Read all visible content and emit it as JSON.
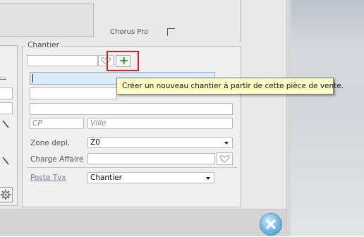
{
  "top": {
    "chorus_label": "Chorus Pro"
  },
  "chantier": {
    "legend": "Chantier",
    "add_button_glyph": "+",
    "add_button_icon": "green-plus-icon",
    "tooltip": "Créer un nouveau chantier à partir de cette pièce de vente.",
    "cp_placeholder": "CP",
    "ville_placeholder": "Ville",
    "zone_label": "Zone depl.",
    "zone_value": "Z0",
    "charge_label": "Charge Affaire",
    "poste_label": "Poste Tvx",
    "poste_value": "Chantier"
  },
  "left_panel": {
    "link_text": "..."
  },
  "colors": {
    "highlight_box": "#e02020",
    "tooltip_bg": "#ffffc6",
    "selected_field": "#dceaf7",
    "plus_green": "#2e9a1e"
  }
}
